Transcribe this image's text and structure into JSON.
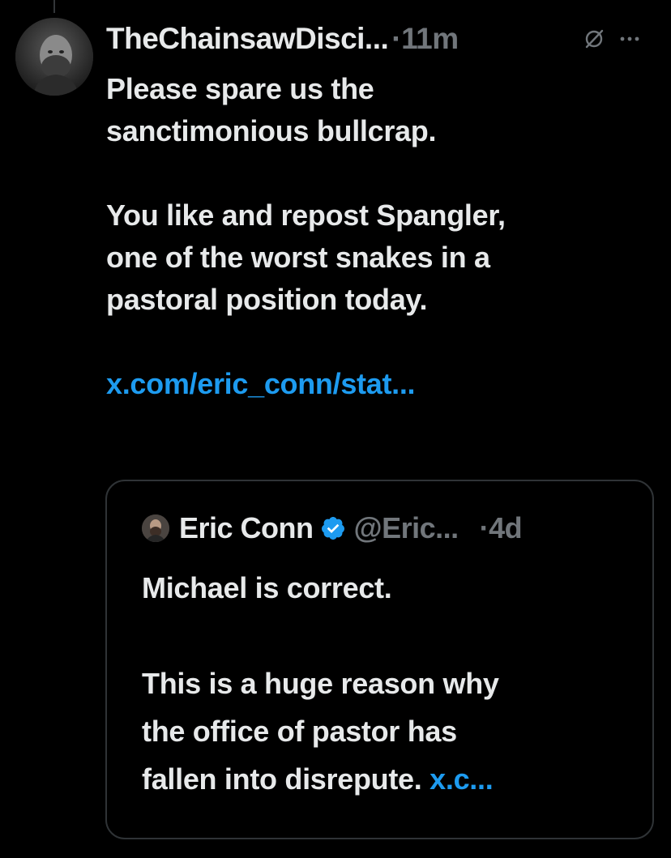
{
  "post": {
    "display_name": "TheChainsawDisci...",
    "time_prefix": "·",
    "time": "11m",
    "text_lines": [
      "Please spare us the",
      "sanctimonious bullcrap."
    ],
    "text_lines_2": [
      "You like and repost Spangler,",
      "one of the worst snakes in a",
      "pastoral position today."
    ],
    "link": "x.com/eric_conn/stat...",
    "icons": [
      "grok-slash-icon",
      "more-dots-icon"
    ]
  },
  "quote": {
    "display_name": "Eric Conn",
    "handle": "@Eric...",
    "time": "·4d",
    "line_1": "Michael is correct.",
    "text_lines": [
      "This is a huge reason why",
      "the office of pastor has"
    ],
    "last_line_text": "fallen into disrepute. ",
    "last_line_link": "x.c...",
    "verified_color": "#1d9bf0"
  },
  "colors": {
    "background": "#000000",
    "text": "#e7e9ea",
    "muted": "#71767b",
    "link": "#1d9bf0",
    "border": "#2f3336"
  }
}
